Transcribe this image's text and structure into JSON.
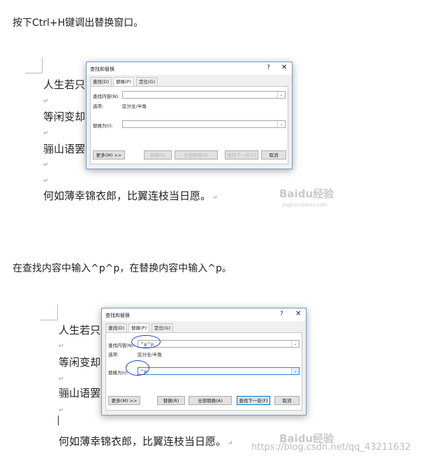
{
  "steps": [
    {
      "text": "按下Ctrl+H键调出替换窗口。"
    },
    {
      "text": "在查找内容中输入^p^p，在替换内容中输入^p。"
    }
  ],
  "document": {
    "lines": [
      "人生若只",
      "等闲变却",
      "骊山语罢",
      "何如薄幸锦衣郎，比翼连枝当日愿。"
    ],
    "paragraph_mark": "↵"
  },
  "dialog": {
    "title": "查找和替换",
    "help": "?",
    "close": "✕",
    "tabs": [
      "查找(D)",
      "替换(P)",
      "定位(G)"
    ],
    "find_label": "查找内容(N):",
    "options_label": "选项:",
    "options_value": "区分全/半角",
    "replace_label": "替换为(I):",
    "more_button": "更多(M) >>",
    "replace_button": "替换(R)",
    "replace_all_button": "全部替换(A)",
    "find_next_button": "查找下一处(F)",
    "cancel_button": "取消",
    "dropdown_glyph": "⌄"
  },
  "shot1": {
    "find_value": "",
    "replace_value": ""
  },
  "shot2": {
    "find_value": "^p^p",
    "replace_value": "^p"
  },
  "watermarks": {
    "baidu_logo": "Baidu经验",
    "jingyan_url": "jingyan.baidu.com",
    "csdn_url": "https://blog.csdn.net/qq_43211632"
  },
  "colors": {
    "ink_annotation": "#1a3fc4",
    "focus_border": "#3c7fd0"
  }
}
